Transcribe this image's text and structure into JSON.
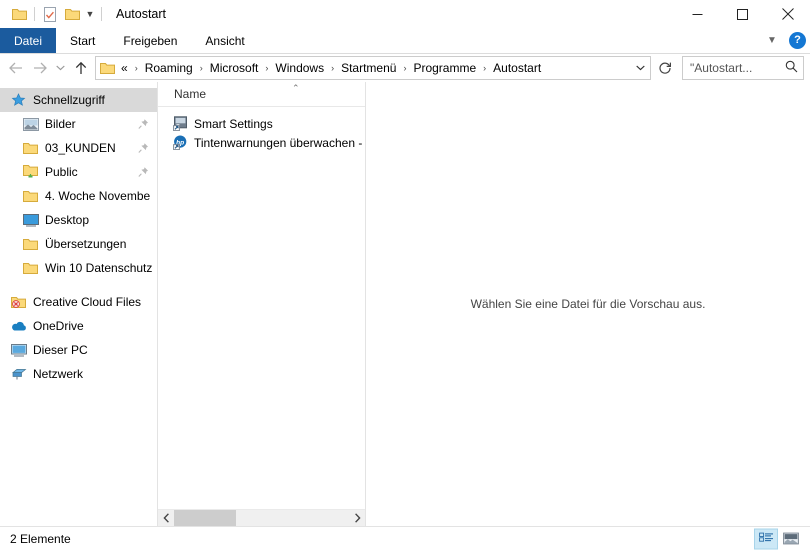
{
  "window": {
    "title": "Autostart",
    "quick_access": [
      {
        "name": "folder-icon",
        "label": "Folder"
      },
      {
        "name": "properties-icon",
        "label": "Eigenschaften"
      },
      {
        "name": "new-folder-icon",
        "label": "Neuer Ordner"
      }
    ],
    "controls": {
      "minimize": "—",
      "maximize": "☐",
      "close": "✕"
    }
  },
  "ribbon": {
    "tabs": [
      {
        "label": "Datei",
        "active": true
      },
      {
        "label": "Start",
        "active": false
      },
      {
        "label": "Freigeben",
        "active": false
      },
      {
        "label": "Ansicht",
        "active": false
      }
    ],
    "collapse_icon": "chevron-down-icon",
    "help_label": "?"
  },
  "address_bar": {
    "back_label": "←",
    "forward_label": "→",
    "history_label": "⌄",
    "up_label": "↑",
    "overflow": "«",
    "separator": "›",
    "crumbs": [
      "Roaming",
      "Microsoft",
      "Windows",
      "Startmenü",
      "Programme",
      "Autostart"
    ],
    "dropdown_label": "⌄",
    "refresh_label": "↻"
  },
  "search": {
    "placeholder": "\"Autostart...",
    "icon": "search-icon"
  },
  "sidebar": {
    "items": [
      {
        "label": "Schnellzugriff",
        "icon": "star-icon",
        "selected": true,
        "root": true,
        "pinned": false
      },
      {
        "label": "Bilder",
        "icon": "pictures-icon",
        "selected": false,
        "root": false,
        "pinned": true
      },
      {
        "label": "03_KUNDEN",
        "icon": "folder-icon",
        "selected": false,
        "root": false,
        "pinned": true
      },
      {
        "label": "Public",
        "icon": "shared-folder-icon",
        "selected": false,
        "root": false,
        "pinned": true
      },
      {
        "label": "4. Woche Novembe",
        "icon": "folder-icon",
        "selected": false,
        "root": false,
        "pinned": false
      },
      {
        "label": "Desktop",
        "icon": "desktop-icon",
        "selected": false,
        "root": false,
        "pinned": false
      },
      {
        "label": "Übersetzungen",
        "icon": "folder-icon",
        "selected": false,
        "root": false,
        "pinned": false
      },
      {
        "label": "Win 10 Datenschutz",
        "icon": "folder-icon",
        "selected": false,
        "root": false,
        "pinned": false
      }
    ],
    "roots": [
      {
        "label": "Creative Cloud Files",
        "icon": "creative-cloud-icon"
      },
      {
        "label": "OneDrive",
        "icon": "onedrive-cloud-icon"
      },
      {
        "label": "Dieser PC",
        "icon": "this-pc-icon"
      },
      {
        "label": "Netzwerk",
        "icon": "network-icon"
      }
    ]
  },
  "file_list": {
    "column_header": "Name",
    "sort_caret": "⌃",
    "files": [
      {
        "name": "Smart Settings",
        "icon": "shortcut-icon"
      },
      {
        "name": "Tintenwarnungen überwachen -",
        "icon": "hp-icon"
      }
    ],
    "scroll_left": "‹",
    "scroll_right": "›"
  },
  "preview": {
    "message": "Wählen Sie eine Datei für die Vorschau aus."
  },
  "status": {
    "text": "2 Elemente",
    "views": [
      {
        "name": "details-view-button",
        "active": true
      },
      {
        "name": "large-icons-view-button",
        "active": false
      }
    ]
  },
  "colors": {
    "accent": "#1b5b9e",
    "folder": "#fbd97a",
    "selection": "#d9d9d9",
    "view_active": "#cce8f6"
  }
}
